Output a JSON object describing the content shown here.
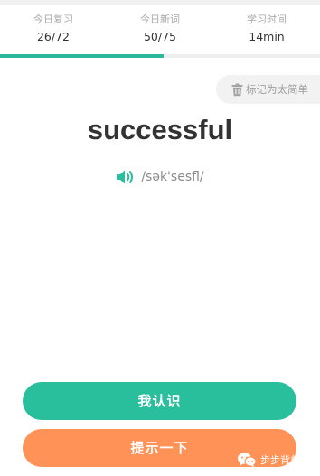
{
  "stats": [
    {
      "label": "今日复习",
      "value": "26/72"
    },
    {
      "label": "今日新词",
      "value": "50/75"
    },
    {
      "label": "学习时间",
      "value": "14min"
    }
  ],
  "progress": {
    "fraction": 0.51,
    "color": "#2ab99a"
  },
  "mark_easy": {
    "label": "标记为太简单",
    "icon": "trash-icon"
  },
  "word": {
    "text": "successful",
    "phonetic": "/sək'sesfl/",
    "audio_icon": "speaker-icon"
  },
  "buttons": {
    "know": "我认识",
    "hint": "提示一下"
  },
  "watermark": {
    "text": "步步背单词",
    "icon": "wechat-icon"
  },
  "colors": {
    "accent_green": "#29bf9c",
    "accent_orange": "#ff9257"
  }
}
